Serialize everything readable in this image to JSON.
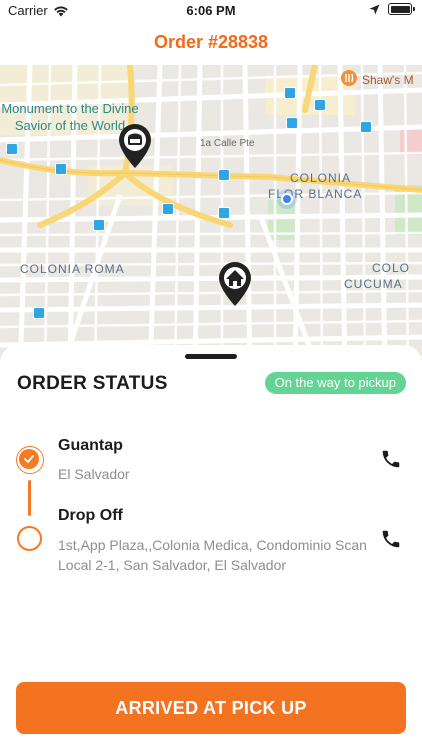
{
  "status_bar": {
    "carrier": "Carrier",
    "time": "6:06 PM"
  },
  "header": {
    "title": "Order #28838"
  },
  "map": {
    "labels": {
      "poi_monument": "Monument to the Divine Savior of the World",
      "poi_shaws": "Shaw's M",
      "street_1a": "1a Calle Pte",
      "colonia_flor_1": "COLONIA",
      "colonia_flor_2": "FLOR BLANCA",
      "colonia_roma": "COLONIA ROMA",
      "colonia_cuc_1": "COLO",
      "colonia_cuc_2": "CUCUMA"
    },
    "icons": {
      "pickup_pin": "store-pin-icon",
      "dropoff_pin": "home-pin-icon",
      "current_location": "current-location-icon",
      "transit": "bus-stop-icon"
    }
  },
  "sheet": {
    "title": "ORDER STATUS",
    "status_badge": "On the way to pickup",
    "stops": [
      {
        "name": "Guantap",
        "address": "El Salvador",
        "state": "completed",
        "icon": "phone-icon"
      },
      {
        "name": "Drop Off",
        "address": "1st,App Plaza,,Colonia Medica, Condominio Scan Local 2-1, San Salvador, El Salvador",
        "state": "pending",
        "icon": "phone-icon"
      }
    ],
    "action_button": "ARRIVED AT PICK UP"
  },
  "colors": {
    "accent": "#f47320",
    "status_green": "#63d493",
    "muted_text": "#8e8e93"
  }
}
